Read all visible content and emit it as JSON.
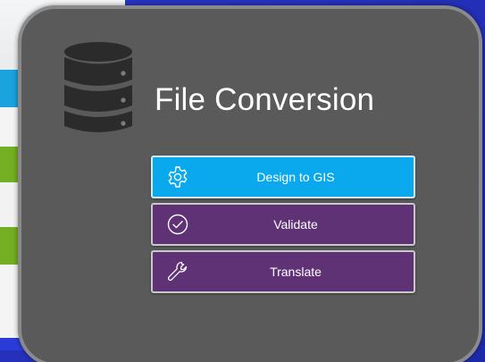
{
  "panel": {
    "title": "File Conversion",
    "icon": "database-icon"
  },
  "actions": [
    {
      "label": "Design to GIS",
      "icon": "gear-icon",
      "color": "#0aa8ec"
    },
    {
      "label": "Validate",
      "icon": "checkmark-circle-icon",
      "color": "#5e3275"
    },
    {
      "label": "Translate",
      "icon": "wrench-icon",
      "color": "#5e3275"
    }
  ],
  "colors": {
    "background": "#2a36c8",
    "panel": "#5a5a5a",
    "panel_border": "#8a8a8a"
  }
}
